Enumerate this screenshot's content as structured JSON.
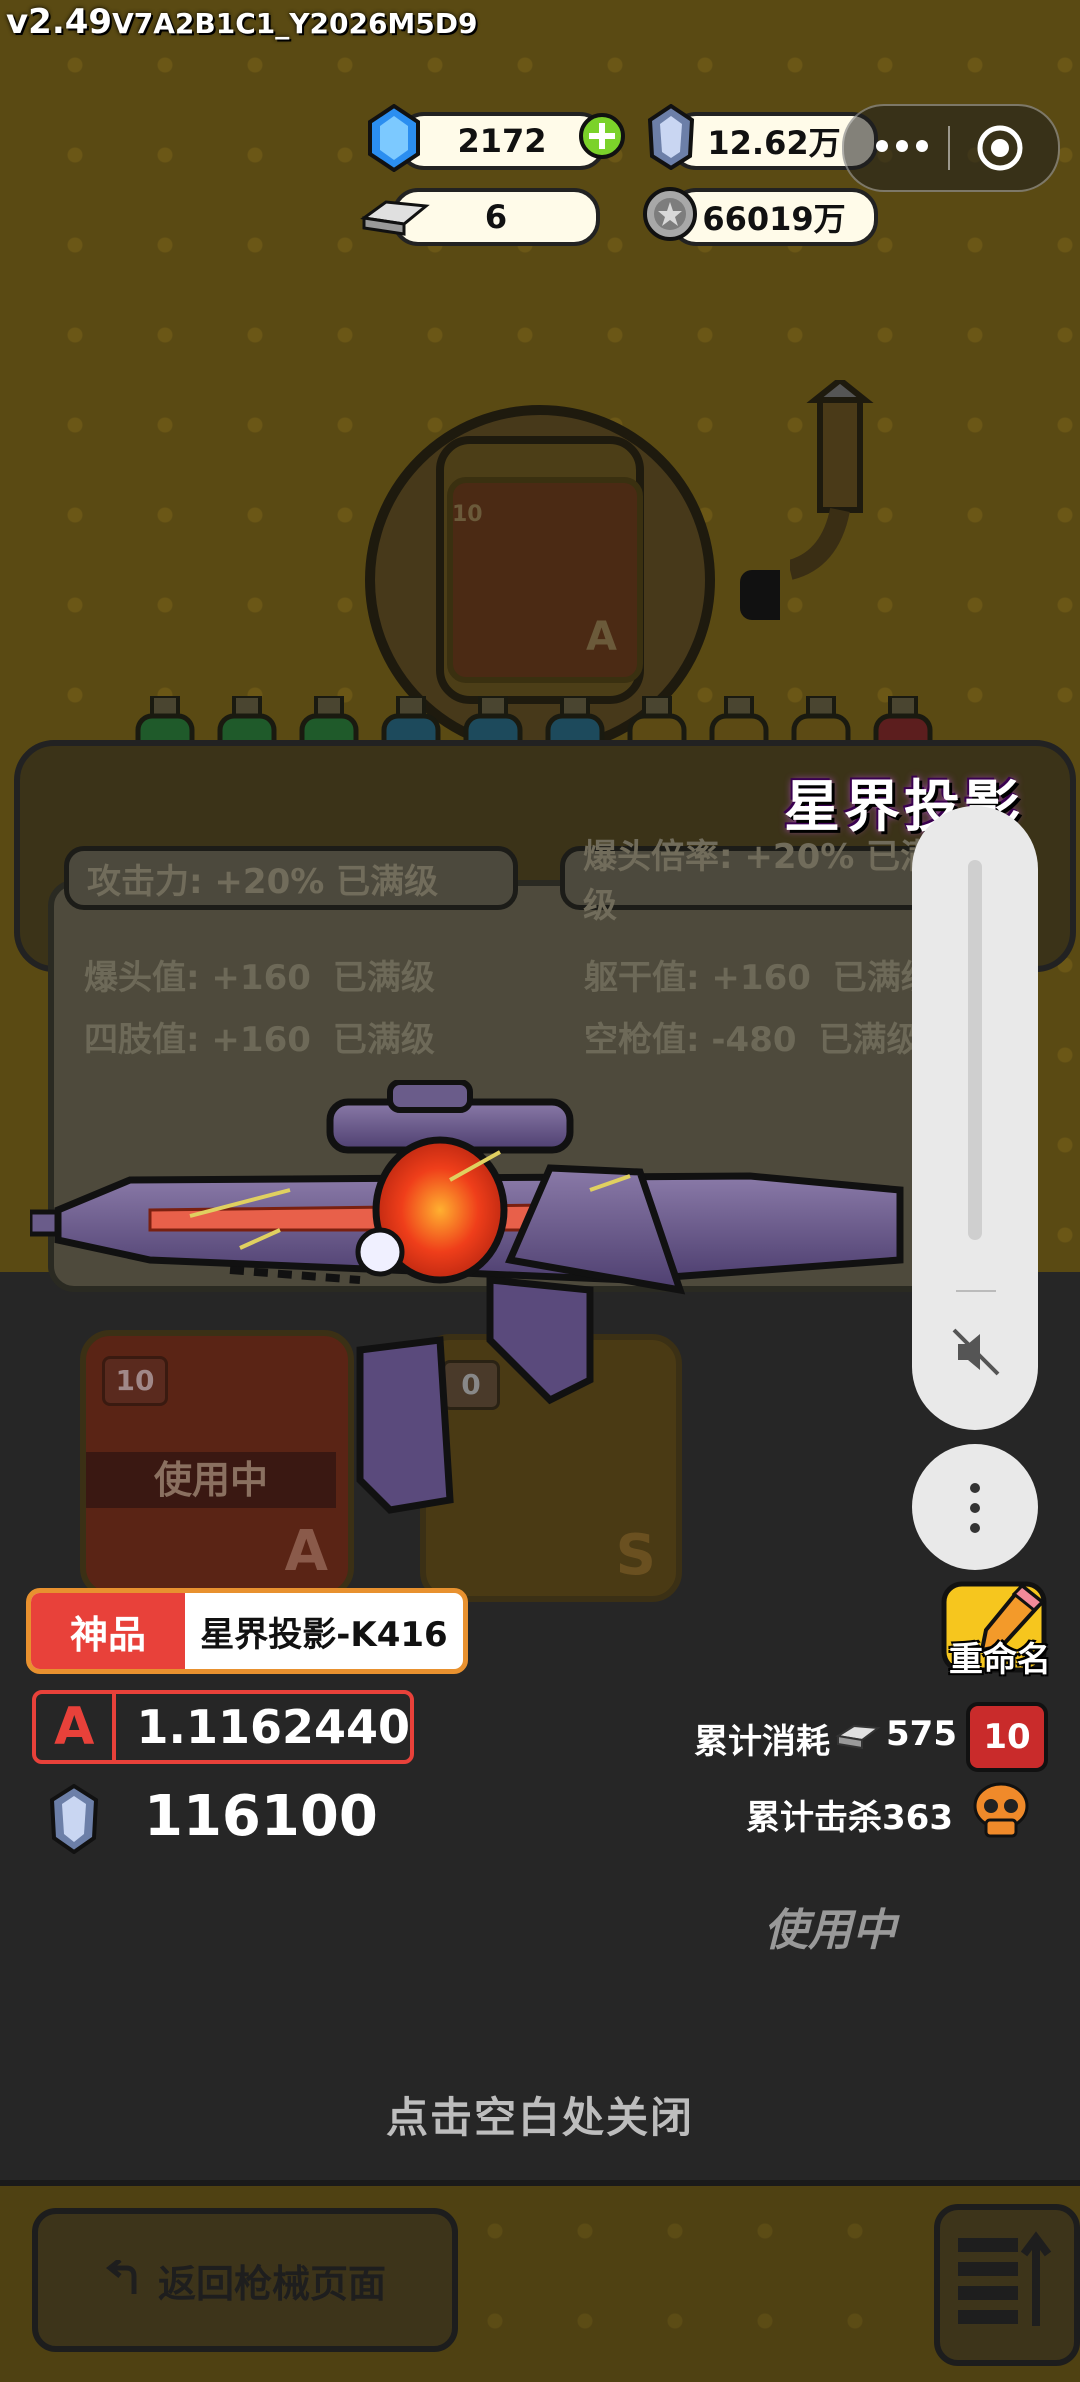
{
  "version": {
    "major": "v2.49",
    "build": "V7A2B1C1_Y2026M5D9"
  },
  "currencies": {
    "gem": "2172",
    "crystal": "12.62万",
    "ingot": "6",
    "coin": "66019万"
  },
  "gun": {
    "title": "星界投影",
    "rarity": "神品",
    "name": "星界投影-K416",
    "grade": "A",
    "grade_value": "1.1162440",
    "price": "116100",
    "consumed_label": "累计消耗",
    "consumed_value": "575",
    "level_badge": "10",
    "kills": "累计击杀363",
    "status": "使用中"
  },
  "stats": {
    "attack": "攻击力: +20%  已满级",
    "headshot_rate": "爆头倍率: +20%  已满级",
    "headshot_val": "爆头值: +160",
    "torso_val": "躯干值: +160",
    "limb_val": "四肢值: +160",
    "empty_val": "空枪值: -480",
    "maxed": "已满级"
  },
  "cards": [
    {
      "level": "10",
      "label": "使用中",
      "grade": "A"
    },
    {
      "level": "0",
      "grade": "S"
    }
  ],
  "machine_card": {
    "level": "10",
    "grade": "A"
  },
  "rename_label": "重命名",
  "close_hint": "点击空白处关闭",
  "back_button": "返回枪械页面",
  "colors": {
    "red": "#e8413a",
    "orange": "#e8912f",
    "bg": "#262626"
  }
}
